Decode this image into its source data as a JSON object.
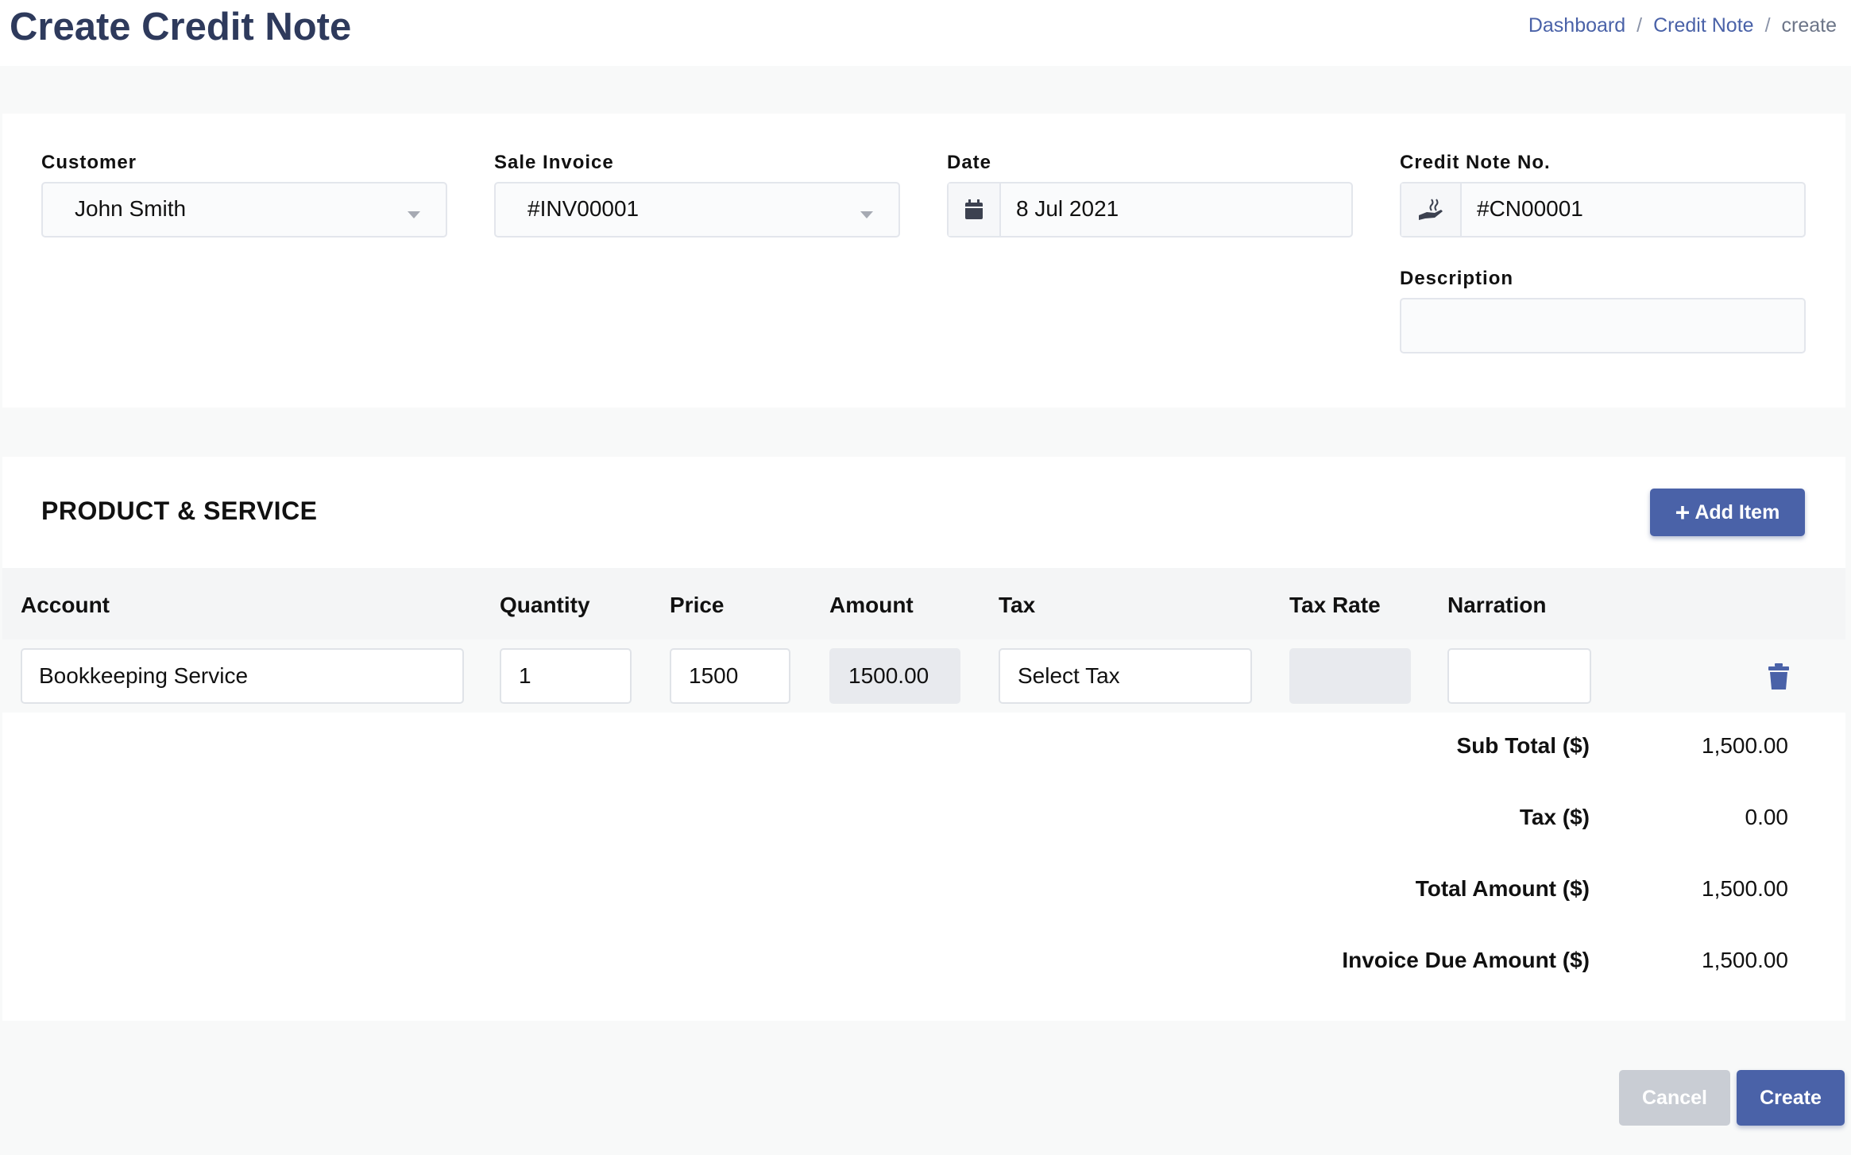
{
  "header": {
    "title": "Create Credit Note",
    "breadcrumb": {
      "dashboard": "Dashboard",
      "sep1": "/",
      "credit_note": "Credit Note",
      "sep2": "/",
      "current": "create"
    }
  },
  "form": {
    "customer": {
      "label": "Customer",
      "value": "John Smith"
    },
    "sale_invoice": {
      "label": "Sale Invoice",
      "value": "#INV00001"
    },
    "date": {
      "label": "Date",
      "value": "8 Jul 2021"
    },
    "credit_note_no": {
      "label": "Credit Note No.",
      "value": "#CN00001"
    },
    "description": {
      "label": "Description",
      "value": ""
    }
  },
  "items": {
    "section_title": "PRODUCT & SERVICE",
    "add_item_label": "Add Item",
    "columns": [
      "Account",
      "Quantity",
      "Price",
      "Amount",
      "Tax",
      "Tax Rate",
      "Narration"
    ],
    "rows": [
      {
        "account": "Bookkeeping Service",
        "quantity": "1",
        "price": "1500",
        "amount": "1500.00",
        "tax": "Select Tax",
        "tax_rate": "",
        "narration": ""
      }
    ]
  },
  "totals": {
    "sub_total": {
      "label": "Sub Total ($)",
      "value": "1,500.00"
    },
    "tax": {
      "label": "Tax ($)",
      "value": "0.00"
    },
    "total_amount": {
      "label": "Total Amount ($)",
      "value": "1,500.00"
    },
    "invoice_due_amount": {
      "label": "Invoice Due Amount ($)",
      "value": "1,500.00"
    }
  },
  "actions": {
    "cancel_label": "Cancel",
    "create_label": "Create"
  },
  "colors": {
    "brand": "#4a62a8",
    "title": "#2e3a5c",
    "cancel": "#c9cdd4"
  },
  "icons": {
    "date_addon": "calendar-icon",
    "credit_note_addon": "hand-holding-icon",
    "row_delete": "trash-icon",
    "add_item": "plus-icon"
  }
}
